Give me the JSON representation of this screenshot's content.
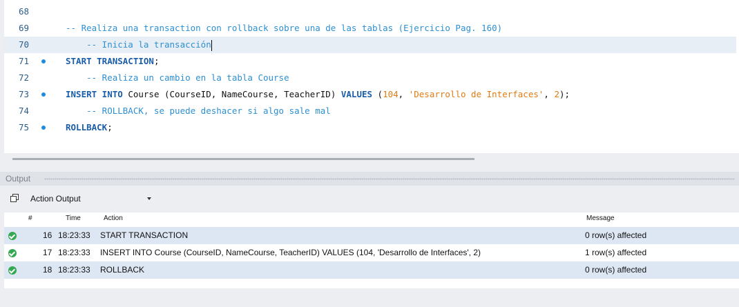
{
  "editor": {
    "lines": [
      {
        "num": "68",
        "dot": false,
        "tokens": []
      },
      {
        "num": "69",
        "dot": false,
        "tokens": [
          {
            "t": "cm",
            "v": "-- Realiza una transaction con rollback sobre una de las tablas (Ejercicio Pag. 160)"
          }
        ]
      },
      {
        "num": "70",
        "dot": false,
        "current": true,
        "tokens": [
          {
            "t": "cm",
            "v": "    -- Inicia la transacción"
          }
        ]
      },
      {
        "num": "71",
        "dot": true,
        "tokens": [
          {
            "t": "kw",
            "v": "START TRANSACTION"
          },
          {
            "t": "plain",
            "v": ";"
          }
        ]
      },
      {
        "num": "72",
        "dot": false,
        "tokens": [
          {
            "t": "cm",
            "v": "    -- Realiza un cambio en la tabla Course"
          }
        ]
      },
      {
        "num": "73",
        "dot": true,
        "tokens": [
          {
            "t": "kw",
            "v": "INSERT INTO"
          },
          {
            "t": "plain",
            "v": " Course (CourseID, NameCourse, TeacherID) "
          },
          {
            "t": "kw",
            "v": "VALUES"
          },
          {
            "t": "plain",
            "v": " ("
          },
          {
            "t": "num",
            "v": "104"
          },
          {
            "t": "plain",
            "v": ", "
          },
          {
            "t": "str",
            "v": "'Desarrollo de Interfaces'"
          },
          {
            "t": "plain",
            "v": ", "
          },
          {
            "t": "num",
            "v": "2"
          },
          {
            "t": "plain",
            "v": ");"
          }
        ]
      },
      {
        "num": "74",
        "dot": false,
        "tokens": [
          {
            "t": "cm",
            "v": "    -- ROLLBACK, se puede deshacer si algo sale mal"
          }
        ]
      },
      {
        "num": "75",
        "dot": true,
        "tokens": [
          {
            "t": "kw",
            "v": "ROLLBACK"
          },
          {
            "t": "plain",
            "v": ";"
          }
        ]
      }
    ]
  },
  "output": {
    "title": "Output",
    "selector_label": "Action Output",
    "selector_icon": "copy-icon",
    "columns": {
      "num": "#",
      "time": "Time",
      "action": "Action",
      "message": "Message"
    },
    "rows": [
      {
        "status": "success-icon",
        "num": "16",
        "time": "18:23:33",
        "action": "START TRANSACTION",
        "message": "0 row(s) affected"
      },
      {
        "status": "success-icon",
        "num": "17",
        "time": "18:23:33",
        "action": "INSERT INTO Course (CourseID, NameCourse, TeacherID) VALUES (104, 'Desarrollo de Interfaces', 2)",
        "message": "1 row(s) affected"
      },
      {
        "status": "success-icon",
        "num": "18",
        "time": "18:23:33",
        "action": "ROLLBACK",
        "message": "0 row(s) affected"
      }
    ]
  },
  "colors": {
    "keyword": "#1a5da8",
    "comment": "#2d8fd1",
    "literal": "#e07b12",
    "success": "#34a853"
  }
}
